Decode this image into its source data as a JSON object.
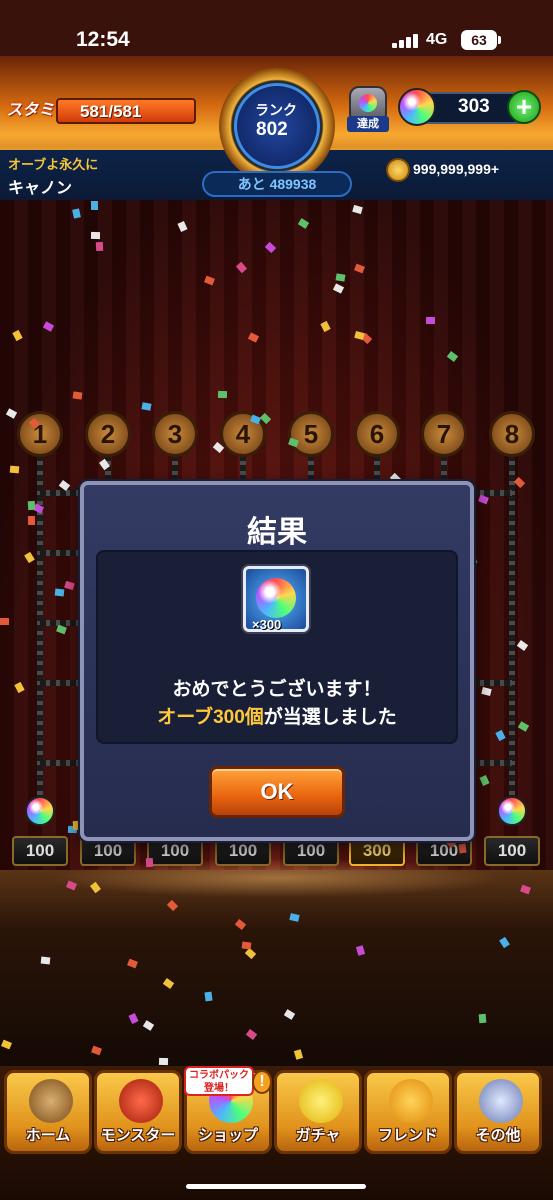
{
  "status_bar": {
    "time": "12:54",
    "network": "4G",
    "battery": "63"
  },
  "header": {
    "stamina_label": "スタミナ",
    "stamina": "581/581",
    "rank_label": "ランク",
    "rank": "802",
    "rank_remaining": "あと 489938",
    "lamp_badge": "達成",
    "orbs": "303",
    "plus": "+",
    "quest_subtitle": "オーブよ永久に",
    "quest_name": "キャノン",
    "coins": "999,999,999+"
  },
  "lanes": {
    "numbers": [
      "1",
      "2",
      "3",
      "4",
      "5",
      "6",
      "7",
      "8"
    ],
    "prizes": [
      "100",
      "100",
      "100",
      "100",
      "100",
      "300",
      "100",
      "100"
    ]
  },
  "dialog": {
    "title": "結果",
    "prize_qty": "×300",
    "message_line1": "おめでとうございます！",
    "message_highlight": "オーブ300個",
    "message_rest": "が当選しました",
    "ok_label": "OK"
  },
  "nav": {
    "items": [
      {
        "label": "ホーム"
      },
      {
        "label": "モンスター"
      },
      {
        "label": "ショップ"
      },
      {
        "label": "ガチャ"
      },
      {
        "label": "フレンド"
      },
      {
        "label": "その他"
      }
    ],
    "collab_badge_line1": "コラボパック",
    "collab_badge_line2": "登場！",
    "alert": "!"
  },
  "colors": {
    "accent_orange": "#e8640e",
    "highlight_gold": "#ffc83a",
    "dialog_bg": "#2b3258"
  }
}
